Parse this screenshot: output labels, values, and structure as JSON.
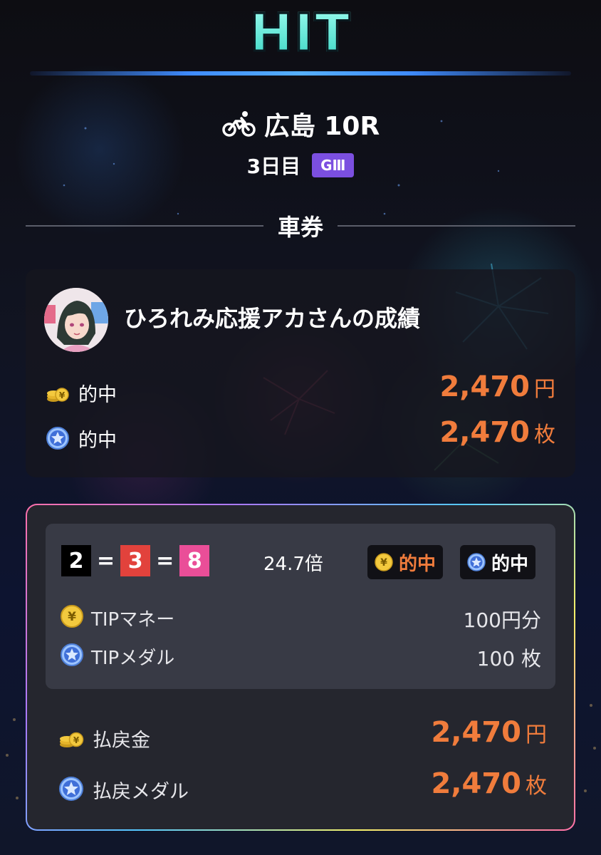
{
  "header": {
    "logo_text": "HIT"
  },
  "race": {
    "venue_round": "広島 10R",
    "day": "3日目",
    "grade": "GⅢ"
  },
  "section": {
    "title": "車券"
  },
  "user_record": {
    "name": "ひろれみ応援アカさんの成績",
    "money_hit": {
      "label": "的中",
      "value": "2,470",
      "unit": "円"
    },
    "medal_hit": {
      "label": "的中",
      "value": "2,470",
      "unit": "枚"
    }
  },
  "bet": {
    "combination": [
      "2",
      "3",
      "8"
    ],
    "separator": "=",
    "odds": "24.7倍",
    "money_hit_label": "的中",
    "medal_hit_label": "的中",
    "tip_money": {
      "label": "TIPマネー",
      "value": "100円分"
    },
    "tip_medal": {
      "label": "TIPメダル",
      "value": "100 枚"
    },
    "payout_money": {
      "label": "払戻金",
      "value": "2,470",
      "unit": "円"
    },
    "payout_medal": {
      "label": "払戻メダル",
      "value": "2,470",
      "unit": "枚"
    }
  },
  "colors": {
    "accent_orange": "#f07c3c",
    "grade_purple": "#7b4fe0",
    "bracket_2": "#000000",
    "bracket_3": "#e2423c",
    "bracket_8": "#ea4e98"
  }
}
